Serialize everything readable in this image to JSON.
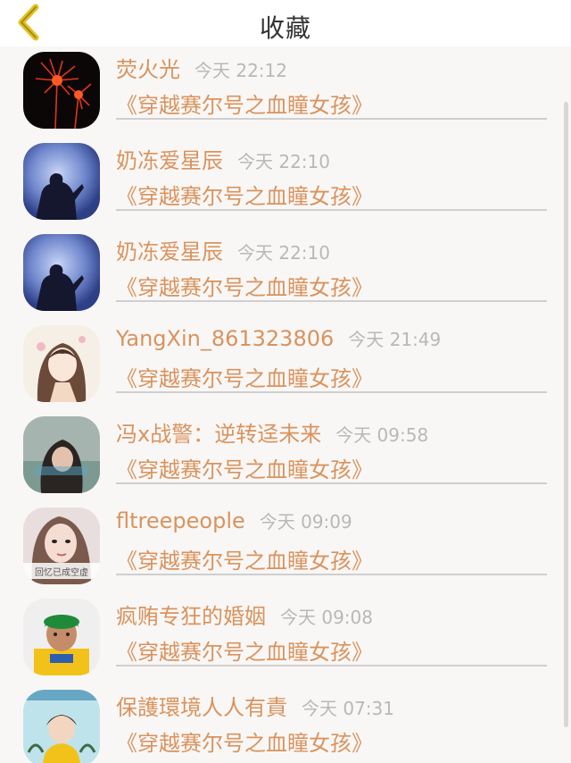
{
  "header": {
    "title": "收藏",
    "back_icon": "chevron-left-icon",
    "accent_color": "#e7c11e"
  },
  "colors": {
    "name": "#d9935d",
    "time": "#b8b8b8",
    "list_bg": "#f9f7f6"
  },
  "favorites": [
    {
      "name": "荧火光",
      "time": "今天 22:12",
      "book": "《穿越赛尔号之血瞳女孩》"
    },
    {
      "name": "奶冻爱星辰",
      "time": "今天 22:10",
      "book": "《穿越赛尔号之血瞳女孩》"
    },
    {
      "name": "奶冻爱星辰",
      "time": "今天 22:10",
      "book": "《穿越赛尔号之血瞳女孩》"
    },
    {
      "name": "YangXin_861323806",
      "time": "今天 21:49",
      "book": "《穿越赛尔号之血瞳女孩》"
    },
    {
      "name": "冯x战警：逆转迳未来",
      "time": "今天 09:58",
      "book": "《穿越赛尔号之血瞳女孩》"
    },
    {
      "name": "fltreepeople",
      "time": "今天 09:09",
      "book": "《穿越赛尔号之血瞳女孩》",
      "avatar_caption": "回忆已成空虚"
    },
    {
      "name": "疯贿专狂的婚姻",
      "time": "今天 09:08",
      "book": "《穿越赛尔号之血瞳女孩》"
    },
    {
      "name": "保護環境人人有責",
      "time": "今天 07:31",
      "book": "《穿越赛尔号之血瞳女孩》"
    }
  ]
}
